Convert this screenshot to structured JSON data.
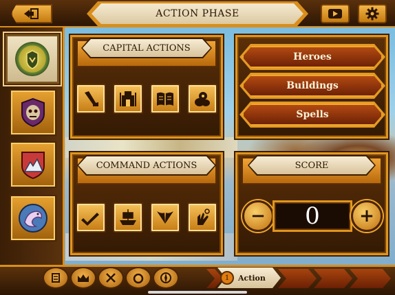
{
  "header": {
    "title": "ACTION PHASE",
    "back_icon": "exit-door-icon",
    "video_icon": "video-play-icon",
    "settings_icon": "gear-icon"
  },
  "sidebar": {
    "factions": [
      {
        "icon": "laurel-crest-icon",
        "selected": true
      },
      {
        "icon": "demon-skull-shield-icon",
        "selected": false
      },
      {
        "icon": "mountain-shield-icon",
        "selected": false
      },
      {
        "icon": "serpent-fish-icon",
        "selected": false
      }
    ]
  },
  "capital_actions": {
    "title": "CAPITAL ACTIONS",
    "buttons": [
      "trowel-icon",
      "building-scaffold-icon",
      "spellbook-icon",
      "resources-pile-icon"
    ]
  },
  "command_actions": {
    "title": "COMMAND ACTIONS",
    "buttons": [
      "boot-march-icon",
      "ship-icon",
      "wings-icon",
      "magic-hand-icon"
    ]
  },
  "menu": {
    "heroes_label": "Heroes",
    "buildings_label": "Buildings",
    "spells_label": "Spells"
  },
  "score": {
    "title": "SCORE",
    "value": "0",
    "minus_label": "−",
    "plus_label": "+"
  },
  "phase_bar": {
    "tabs": [
      "scroll-icon",
      "crown-icon",
      "crossed-swords-icon",
      "ring-icon",
      "compass-icon"
    ],
    "current_number": "1",
    "current_label": "Action"
  },
  "colors": {
    "gold": "#e0961e",
    "dark_brown": "#341a04",
    "red_button": "#8e3208",
    "parchment": "#f0e4c4"
  }
}
